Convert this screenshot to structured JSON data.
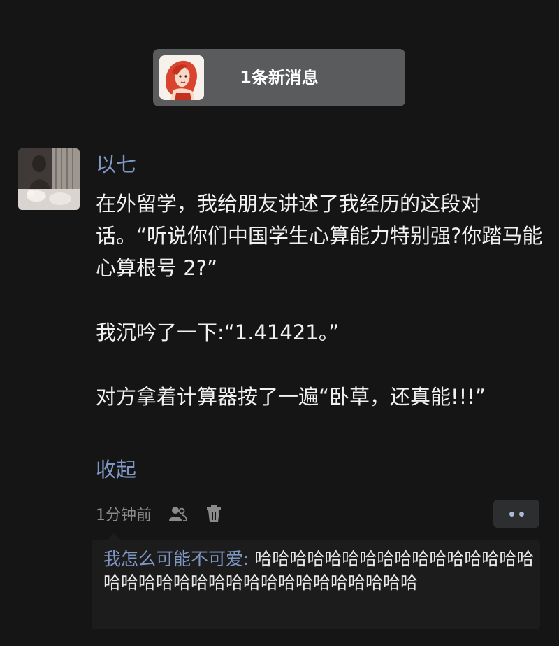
{
  "notification": {
    "text": "1条新消息"
  },
  "post": {
    "author": "以七",
    "paragraphs": [
      "在外留学，我给朋友讲述了我经历的这段对话。“听说你们中国学生心算能力特别强?你踏马能心算根号 2?”",
      "我沉吟了一下:“1.41421。”",
      "对方拿着计算器按了一遍“卧草，还真能!!!”"
    ],
    "collapse_label": "收起",
    "time": "1分钟前",
    "icons": [
      "user-like-icon",
      "trash-icon",
      "more-dots-icon"
    ]
  },
  "comments": [
    {
      "name": "我怎么可能不可爱",
      "separator": ": ",
      "text": "哈哈哈哈哈哈哈哈哈哈哈哈哈哈哈哈哈哈哈哈哈哈哈哈哈哈哈哈哈哈哈哈哈哈"
    }
  ],
  "colors": {
    "background": "#151515",
    "link_blue": "#7f97c4",
    "banner": "#5a5b5d",
    "text": "#f1f1f1"
  }
}
